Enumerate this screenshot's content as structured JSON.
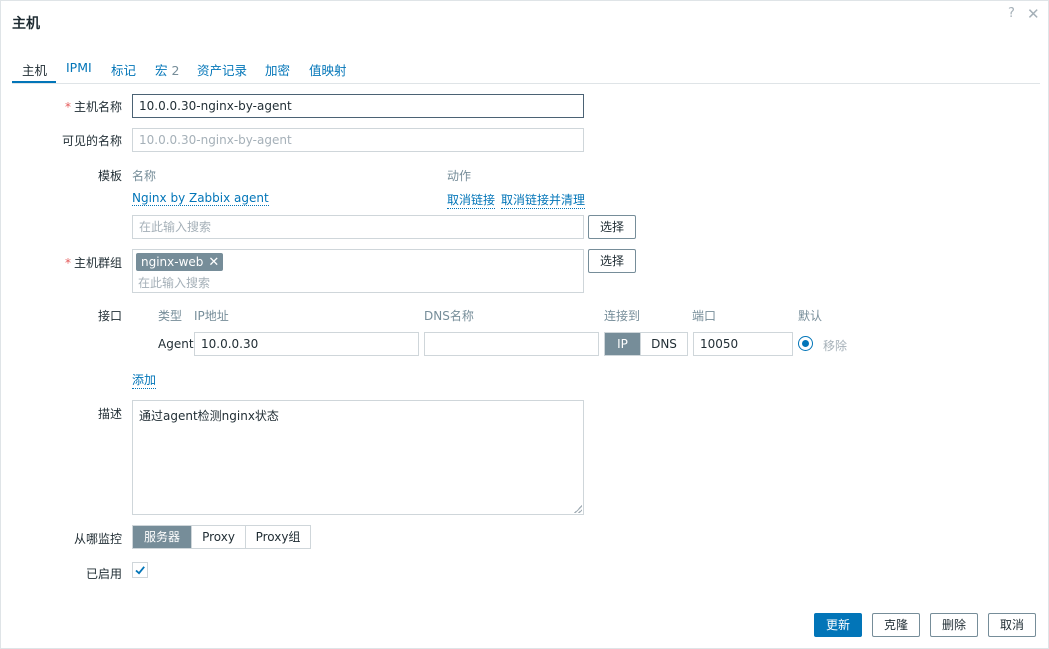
{
  "dialog": {
    "title": "主机",
    "help_icon": "?",
    "close_icon": "✕"
  },
  "tabs": [
    {
      "label": "主机"
    },
    {
      "label": "IPMI"
    },
    {
      "label": "标记"
    },
    {
      "label": "宏",
      "count": "2"
    },
    {
      "label": "资产记录"
    },
    {
      "label": "加密"
    },
    {
      "label": "值映射"
    }
  ],
  "form": {
    "host_name": {
      "label": "主机名称",
      "value": "10.0.0.30-nginx-by-agent"
    },
    "visible_name": {
      "label": "可见的名称",
      "placeholder": "10.0.0.30-nginx-by-agent"
    },
    "templates": {
      "label": "模板",
      "col_name": "名称",
      "col_action": "动作",
      "items": [
        {
          "name": "Nginx by Zabbix agent",
          "unlink": "取消链接",
          "unlink_clear": "取消链接并清理"
        }
      ],
      "search_placeholder": "在此输入搜索",
      "select": "选择"
    },
    "host_groups": {
      "label": "主机群组",
      "tags": [
        {
          "name": "nginx-web",
          "remove": "✕"
        }
      ],
      "search_placeholder": "在此输入搜索",
      "select": "选择"
    },
    "interfaces": {
      "label": "接口",
      "col_type": "类型",
      "col_ip": "IP地址",
      "col_dns": "DNS名称",
      "col_connect": "连接到",
      "col_port": "端口",
      "col_default": "默认",
      "rows": [
        {
          "type": "Agent",
          "ip": "10.0.0.30",
          "dns": "",
          "connect_ip": "IP",
          "connect_dns": "DNS",
          "port": "10050",
          "remove": "移除"
        }
      ],
      "add": "添加"
    },
    "description": {
      "label": "描述",
      "value": "通过agent检测nginx状态"
    },
    "monitored_by": {
      "label": "从哪监控",
      "options": [
        "服务器",
        "Proxy",
        "Proxy组"
      ],
      "selected": "服务器"
    },
    "enabled": {
      "label": "已启用",
      "checked": true
    }
  },
  "buttons": {
    "update": "更新",
    "clone": "克隆",
    "delete": "删除",
    "cancel": "取消"
  }
}
